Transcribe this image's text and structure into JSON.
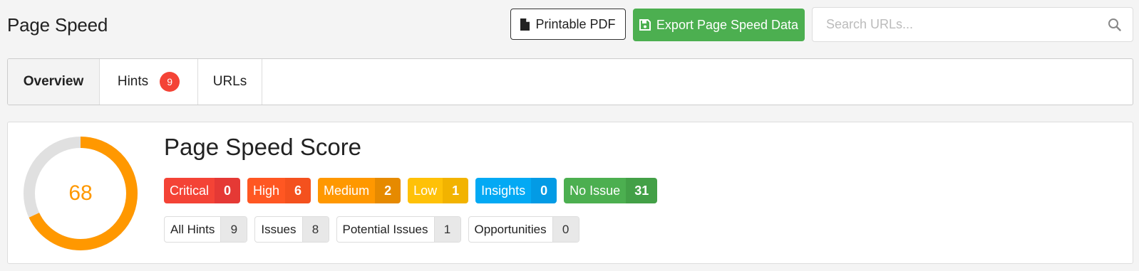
{
  "header": {
    "title": "Page Speed",
    "pdf_button": "Printable PDF",
    "export_button": "Export Page Speed Data",
    "search_placeholder": "Search URLs..."
  },
  "tabs": [
    {
      "label": "Overview",
      "active": true
    },
    {
      "label": "Hints",
      "badge": "9"
    },
    {
      "label": "URLs"
    }
  ],
  "score": {
    "title": "Page Speed Score",
    "value": "68",
    "fraction": 0.68,
    "gauge_color": "#ff9800",
    "track_color": "#e0e0e0"
  },
  "severities": [
    {
      "label": "Critical",
      "count": "0",
      "color": "#f44336",
      "count_color": "#e53935"
    },
    {
      "label": "High",
      "count": "6",
      "color": "#ff5722",
      "count_color": "#f4511e"
    },
    {
      "label": "Medium",
      "count": "2",
      "color": "#ff9800",
      "count_color": "#e68a00"
    },
    {
      "label": "Low",
      "count": "1",
      "color": "#ffc107",
      "count_color": "#f2b300"
    },
    {
      "label": "Insights",
      "count": "0",
      "color": "#03a9f4",
      "count_color": "#039be5"
    },
    {
      "label": "No Issue",
      "count": "31",
      "color": "#4caf50",
      "count_color": "#43a047"
    }
  ],
  "categories": [
    {
      "label": "All Hints",
      "count": "9"
    },
    {
      "label": "Issues",
      "count": "8"
    },
    {
      "label": "Potential Issues",
      "count": "1"
    },
    {
      "label": "Opportunities",
      "count": "0"
    }
  ],
  "icons": {
    "pdf": "file-icon",
    "export": "floppy-disk-icon",
    "search": "search-icon"
  }
}
